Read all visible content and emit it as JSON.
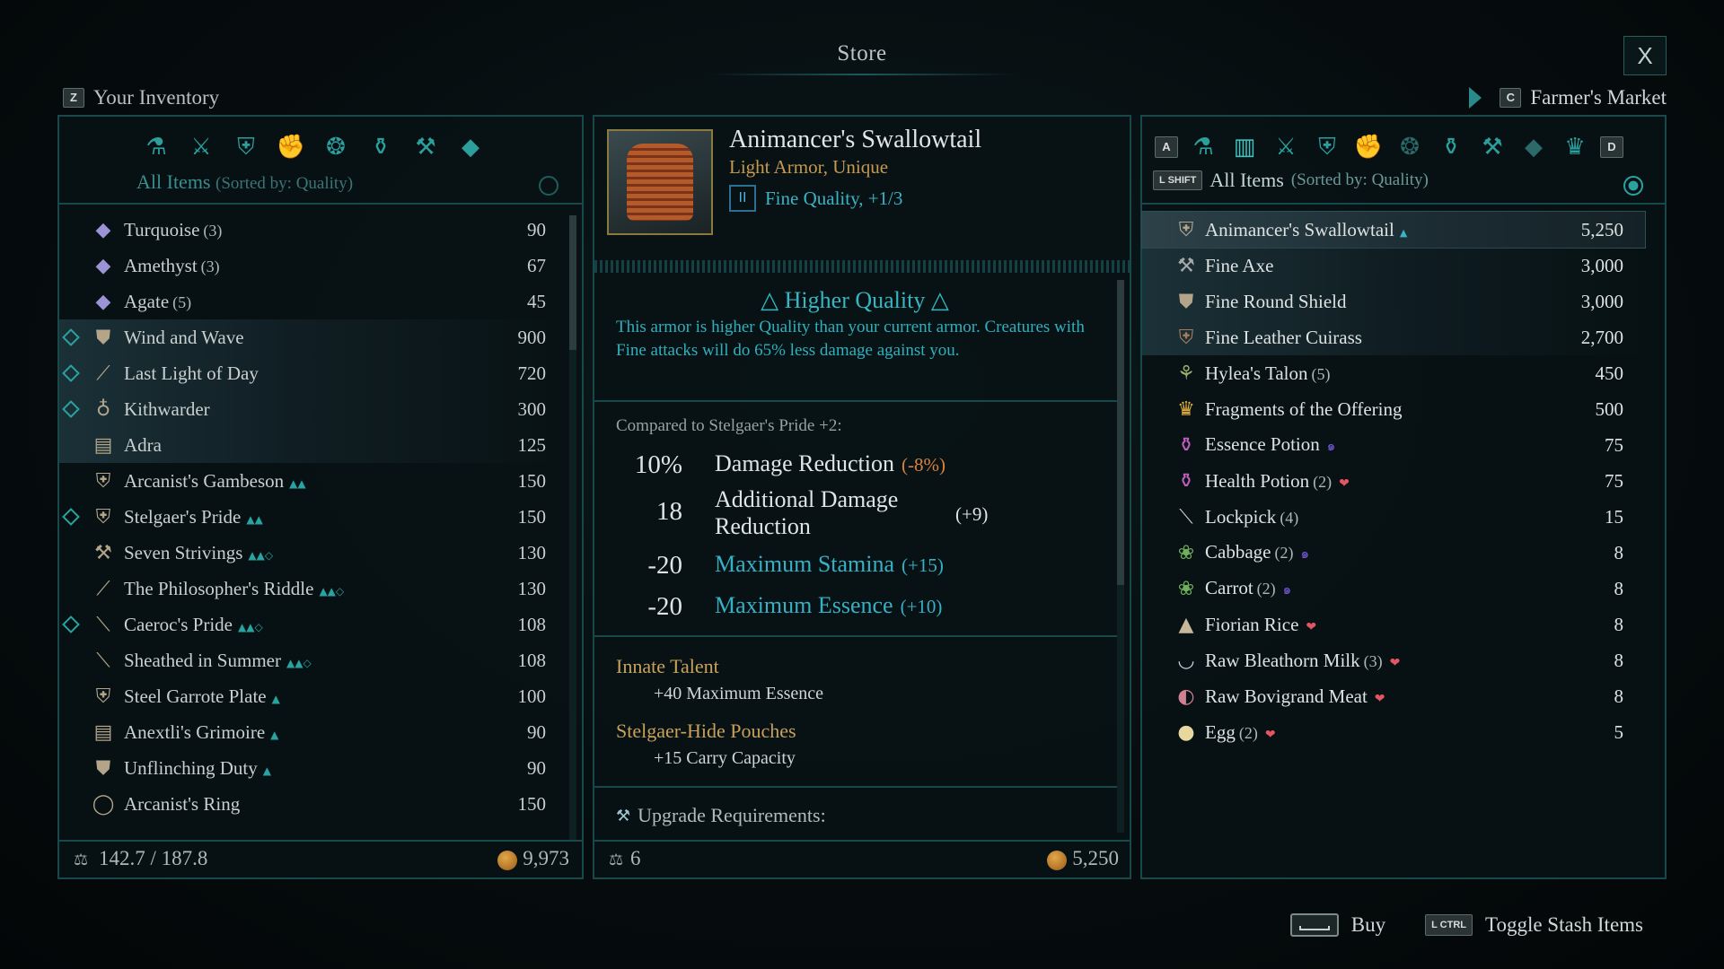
{
  "header": {
    "title": "Store",
    "close_label": "X",
    "inventory_key": "Z",
    "inventory_label": "Your Inventory",
    "market_key": "C",
    "market_label": "Farmer's Market"
  },
  "left": {
    "category_icons": [
      "all-items-icon",
      "weapons-icon",
      "armor-icon",
      "gauntlets-icon",
      "rings-icon",
      "potions-icon",
      "crafting-icon",
      "gems-icon"
    ],
    "filter_label": "All Items",
    "filter_sort": "(Sorted by: Quality)",
    "items": [
      {
        "name": "Turquoise",
        "count": "(3)",
        "value": "90",
        "icon": "gem-icon",
        "new": false
      },
      {
        "name": "Amethyst",
        "count": "(3)",
        "value": "67",
        "icon": "gem-icon",
        "new": false
      },
      {
        "name": "Agate",
        "count": "(5)",
        "value": "45",
        "icon": "gem-icon",
        "new": false
      },
      {
        "name": "Wind and Wave",
        "count": "",
        "value": "900",
        "icon": "shield-icon",
        "new": true
      },
      {
        "name": "Last Light of Day",
        "count": "",
        "value": "720",
        "icon": "sword-icon",
        "new": true
      },
      {
        "name": "Kithwarder",
        "count": "",
        "value": "300",
        "icon": "amulet-icon",
        "new": true
      },
      {
        "name": "Adra",
        "count": "",
        "value": "125",
        "icon": "grimoire-icon",
        "new": false
      },
      {
        "name": "Arcanist's Gambeson",
        "count": "",
        "value": "150",
        "icon": "armor-icon",
        "new": false
      },
      {
        "name": "Stelgaer's Pride",
        "count": "",
        "value": "150",
        "icon": "armor-icon",
        "new": true
      },
      {
        "name": "Seven Strivings",
        "count": "",
        "value": "130",
        "icon": "hammer-icon",
        "new": false
      },
      {
        "name": "The Philosopher's Riddle",
        "count": "",
        "value": "130",
        "icon": "sword-icon",
        "new": false
      },
      {
        "name": "Caeroc's Pride",
        "count": "",
        "value": "108",
        "icon": "dagger-icon",
        "new": true
      },
      {
        "name": "Sheathed in Summer",
        "count": "",
        "value": "108",
        "icon": "dagger-icon",
        "new": false
      },
      {
        "name": "Steel Garrote Plate",
        "count": "",
        "value": "100",
        "icon": "armor-icon",
        "new": false
      },
      {
        "name": "Anextli's Grimoire",
        "count": "",
        "value": "90",
        "icon": "grimoire-icon",
        "new": false
      },
      {
        "name": "Unflinching Duty",
        "count": "",
        "value": "90",
        "icon": "shield-icon",
        "new": false
      },
      {
        "name": "Arcanist's Ring",
        "count": "",
        "value": "150",
        "icon": "ring-icon",
        "new": false
      }
    ],
    "weight": "142.7 / 187.8",
    "gold": "9,973"
  },
  "detail": {
    "name": "Animancer's Swallowtail",
    "type": "Light Armor, Unique",
    "quality_badge": "II",
    "quality": "Fine Quality, +1/3",
    "hq_title": "Higher Quality",
    "hq_desc": "This armor is higher Quality than your current armor. Creatures with Fine attacks will do 65% less damage against you.",
    "compare_label": "Compared to Stelgaer's Pride +2:",
    "stats": [
      {
        "num": "10%",
        "label": "Damage Reduction",
        "delta": "(-8%)"
      },
      {
        "num": "18",
        "label": "Additional Damage Reduction",
        "delta": "(+9)"
      },
      {
        "num": "-20",
        "label": "Maximum Stamina",
        "delta": "(+15)"
      },
      {
        "num": "-20",
        "label": "Maximum Essence",
        "delta": "(+10)"
      }
    ],
    "talent1_title": "Innate Talent",
    "talent1_value": "+40 Maximum Essence",
    "talent2_title": "Stelgaer-Hide Pouches",
    "talent2_value": "+15 Carry Capacity",
    "upgrade_label": "Upgrade Requirements:",
    "weight": "6",
    "price": "5,250"
  },
  "right": {
    "prev_key": "A",
    "next_key": "D",
    "filter_key": "L SHIFT",
    "filter_label": "All Items",
    "filter_sort": "(Sorted by: Quality)",
    "items": [
      {
        "name": "Animancer's Swallowtail",
        "count": "",
        "value": "5,250",
        "icon": "armor-icon"
      },
      {
        "name": "Fine Axe",
        "count": "",
        "value": "3,000",
        "icon": "axe-icon"
      },
      {
        "name": "Fine Round Shield",
        "count": "",
        "value": "3,000",
        "icon": "shield-icon"
      },
      {
        "name": "Fine Leather Cuirass",
        "count": "",
        "value": "2,700",
        "icon": "cuirass-icon"
      },
      {
        "name": "Hylea's Talon",
        "count": "(5)",
        "value": "450",
        "icon": "talon-icon"
      },
      {
        "name": "Fragments of the Offering",
        "count": "",
        "value": "500",
        "icon": "crown-icon"
      },
      {
        "name": "Essence Potion",
        "count": "",
        "value": "75",
        "icon": "potion-icon"
      },
      {
        "name": "Health Potion",
        "count": "(2)",
        "value": "75",
        "icon": "potion-icon"
      },
      {
        "name": "Lockpick",
        "count": "(4)",
        "value": "15",
        "icon": "lockpick-icon"
      },
      {
        "name": "Cabbage",
        "count": "(2)",
        "value": "8",
        "icon": "cabbage-icon"
      },
      {
        "name": "Carrot",
        "count": "(2)",
        "value": "8",
        "icon": "carrot-icon"
      },
      {
        "name": "Fiorian Rice",
        "count": "",
        "value": "8",
        "icon": "rice-icon"
      },
      {
        "name": "Raw Bleathorn Milk",
        "count": "(3)",
        "value": "8",
        "icon": "milk-icon"
      },
      {
        "name": "Raw Bovigrand Meat",
        "count": "",
        "value": "8",
        "icon": "meat-icon"
      },
      {
        "name": "Egg",
        "count": "(2)",
        "value": "5",
        "icon": "egg-icon"
      }
    ]
  },
  "prompts": {
    "buy_label": "Buy",
    "stash_key": "L CTRL",
    "stash_label": "Toggle Stash Items"
  },
  "colors": {
    "accent": "#2aa3a0",
    "gold": "#c8a25a",
    "negative": "#d8823a",
    "quality": "#35b0c4"
  }
}
